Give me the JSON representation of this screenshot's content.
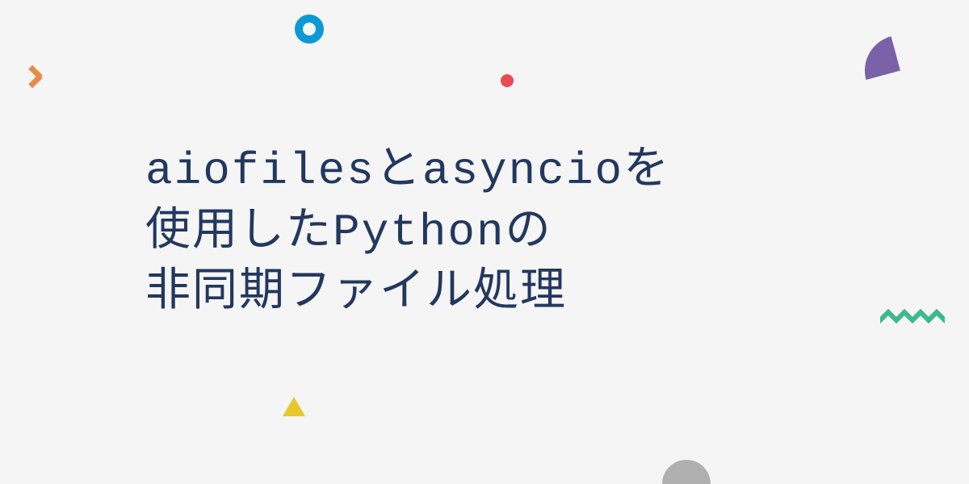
{
  "title": {
    "line1": "aiofilesとasyncioを",
    "line2": "使用したPythonの",
    "line3": "非同期ファイル処理"
  },
  "colors": {
    "background": "#f5f5f5",
    "text": "#23385e",
    "orange": "#e88b4a",
    "blue": "#0d99d6",
    "red": "#e94b52",
    "purple": "#7b61a8",
    "green": "#3eb88e",
    "yellow": "#e8c82a",
    "gray": "#b0b0b0"
  }
}
